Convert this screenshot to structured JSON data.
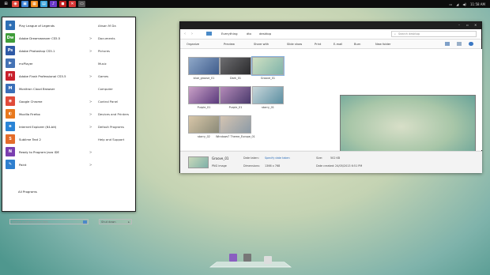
{
  "taskbar": {
    "icons": [
      {
        "name": "start-button",
        "color": "#ffffff",
        "glyph": "⊞"
      },
      {
        "name": "chrome-taskbar",
        "color": "#e0463a",
        "glyph": "◉"
      },
      {
        "name": "photos-taskbar",
        "color": "#3c83d6",
        "glyph": "▣"
      },
      {
        "name": "calendar-taskbar",
        "color": "#f08a1c",
        "glyph": "▦"
      },
      {
        "name": "explorer-taskbar",
        "color": "#3aa3da",
        "glyph": "▤"
      },
      {
        "name": "music-taskbar",
        "color": "#6b3ac8",
        "glyph": "♪"
      },
      {
        "name": "red-app-taskbar",
        "color": "#c02020",
        "glyph": "◼"
      },
      {
        "name": "close-app-taskbar",
        "color": "#d63636",
        "glyph": "✕"
      },
      {
        "name": "app-taskbar",
        "color": "#555555",
        "glyph": "▭"
      }
    ],
    "clock": "11:58 AM"
  },
  "start_menu": {
    "programs": [
      {
        "label": "Play League of Legends",
        "color": "#2e6fb5",
        "glyph": "◈",
        "arrow": ""
      },
      {
        "label": "Adobe Dreamweaver CS5.5",
        "color": "#3f9d3a",
        "glyph": "Dw",
        "arrow": ">"
      },
      {
        "label": "Adobe Photoshop CS5.1",
        "color": "#2f5aa6",
        "glyph": "Ps",
        "arrow": ">"
      },
      {
        "label": "mcPlayer",
        "color": "#4573b5",
        "glyph": "▶",
        "arrow": ""
      },
      {
        "label": "Adobe Flash Professional CS5.5",
        "color": "#c8202c",
        "glyph": "Fl",
        "arrow": ">"
      },
      {
        "label": "Monitron Cloud Browser",
        "color": "#3a6fb8",
        "glyph": "M",
        "arrow": ""
      },
      {
        "label": "Google Chrome",
        "color": "#e04b3a",
        "glyph": "◉",
        "arrow": ">"
      },
      {
        "label": "Mozilla Firefox",
        "color": "#e8791e",
        "glyph": "◐",
        "arrow": ">"
      },
      {
        "label": "Internet Explorer (64-bit)",
        "color": "#2a84d6",
        "glyph": "e",
        "arrow": ">"
      },
      {
        "label": "Sublime Text 2",
        "color": "#e46c2a",
        "glyph": "S",
        "arrow": ""
      },
      {
        "label": "Ready to Program Java IDE",
        "color": "#7a3fb0",
        "glyph": "N",
        "arrow": ">"
      },
      {
        "label": "Paint",
        "color": "#2f7fcf",
        "glyph": "✎",
        "arrow": ">"
      }
    ],
    "all_programs": "All Programs",
    "search_placeholder": "Search programs and files",
    "right_links": [
      "Ahsan M Da",
      "Documents",
      "Pictures",
      "Music",
      "Games",
      "Computer",
      "Control Panel",
      "Devices and Printers",
      "Default Programs",
      "Help and Support"
    ],
    "shutdown": "Shut down"
  },
  "explorer": {
    "breadcrumb": [
      "Everything",
      "dtx",
      "desktop"
    ],
    "search_placeholder": "Search desktop",
    "commands": [
      "Organize",
      "Preview",
      "Share with",
      "Slide show",
      "Print",
      "E-mail",
      "Burn",
      "New folder"
    ],
    "files": [
      {
        "label": "blue_groove_01",
        "c1": "#8fa8c8",
        "c2": "#3f5c8c"
      },
      {
        "label": "Dark_01",
        "c1": "#6d6d70",
        "c2": "#2a2a2c"
      },
      {
        "label": "Groove_01",
        "c1": "#cfe0c2",
        "c2": "#7fb3aa"
      },
      {
        "label": "Purple_01",
        "c1": "#c9a0c6",
        "c2": "#5a3a7c"
      },
      {
        "label": "Purple_01",
        "c1": "#b48ab8",
        "c2": "#4a3a6c"
      },
      {
        "label": "starry_01",
        "c1": "#c8d6da",
        "c2": "#5c8fa2"
      },
      {
        "label": "starry_02",
        "c1": "#d8c6a8",
        "c2": "#8a8a78"
      },
      {
        "label": "Windows7 Theme_Europe_01",
        "c1": "#d4c4b2",
        "c2": "#8c9aa6"
      }
    ],
    "details": {
      "name": "Groove_01",
      "type": "PNG image",
      "date_taken_label": "Date taken:",
      "date_taken": "Specify date taken",
      "dimensions_label": "Dimensions:",
      "dimensions": "1366 x 768",
      "size_label": "Size:",
      "size": "502 KB",
      "created_label": "Date created:",
      "created": "24/05/2013 6:51 PM"
    }
  },
  "dock": {
    "items": [
      {
        "name": "photos-dock",
        "color": "#8a5fc0"
      },
      {
        "name": "trash-dock",
        "color": "#777777"
      },
      {
        "name": "folder-dock",
        "color": "#dddddd"
      }
    ]
  }
}
